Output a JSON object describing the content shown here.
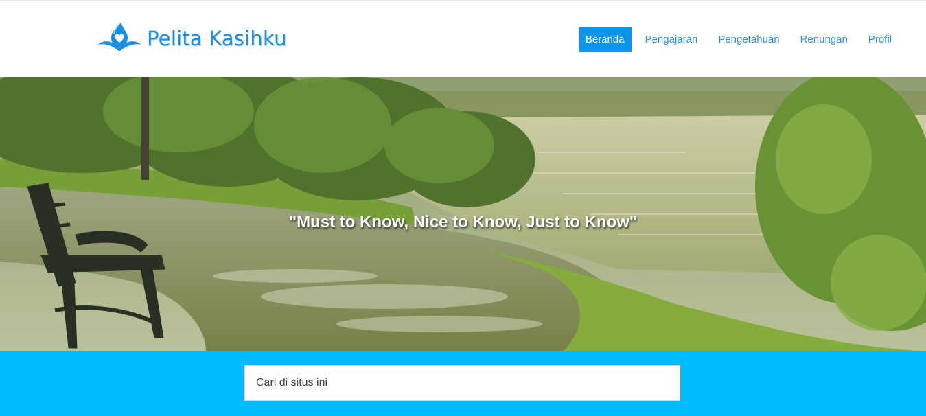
{
  "brand": {
    "name": "Pelita Kasihku",
    "color": "#1a8fe0"
  },
  "nav": {
    "items": [
      {
        "label": "Beranda",
        "active": true
      },
      {
        "label": "Pengajaran",
        "active": false
      },
      {
        "label": "Pengetahuan",
        "active": false
      },
      {
        "label": "Renungan",
        "active": false
      },
      {
        "label": "Profil",
        "active": false
      }
    ],
    "active_color": "#0a96ea"
  },
  "hero": {
    "tagline": "\"Must to Know, Nice to Know, Just to Know\"",
    "image": "park-lake-bench-photo"
  },
  "search": {
    "placeholder": "Cari di situs ini",
    "value": "",
    "band_color": "#00bbff"
  }
}
